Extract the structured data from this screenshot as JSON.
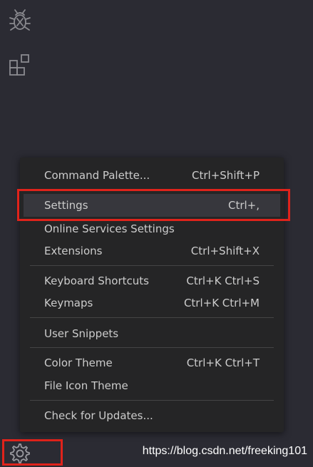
{
  "activity_bar": {
    "icons": [
      "debug-icon",
      "extensions-icon"
    ],
    "bottom_icon": "gear-icon"
  },
  "menu": {
    "items": [
      {
        "label": "Command Palette...",
        "shortcut": "Ctrl+Shift+P"
      },
      {
        "label": "Settings",
        "shortcut": "Ctrl+,"
      },
      {
        "label": "Online Services Settings",
        "shortcut": ""
      },
      {
        "label": "Extensions",
        "shortcut": "Ctrl+Shift+X"
      },
      {
        "label": "Keyboard Shortcuts",
        "shortcut": "Ctrl+K Ctrl+S"
      },
      {
        "label": "Keymaps",
        "shortcut": "Ctrl+K Ctrl+M"
      },
      {
        "label": "User Snippets",
        "shortcut": ""
      },
      {
        "label": "Color Theme",
        "shortcut": "Ctrl+K Ctrl+T"
      },
      {
        "label": "File Icon Theme",
        "shortcut": ""
      },
      {
        "label": "Check for Updates...",
        "shortcut": ""
      }
    ],
    "selected_index": 1
  },
  "colors": {
    "background": "#2b2b33",
    "menu_background": "#252526",
    "highlight_border": "#e0231b",
    "text": "#cccccc"
  },
  "watermark": "https://blog.csdn.net/freeking101"
}
